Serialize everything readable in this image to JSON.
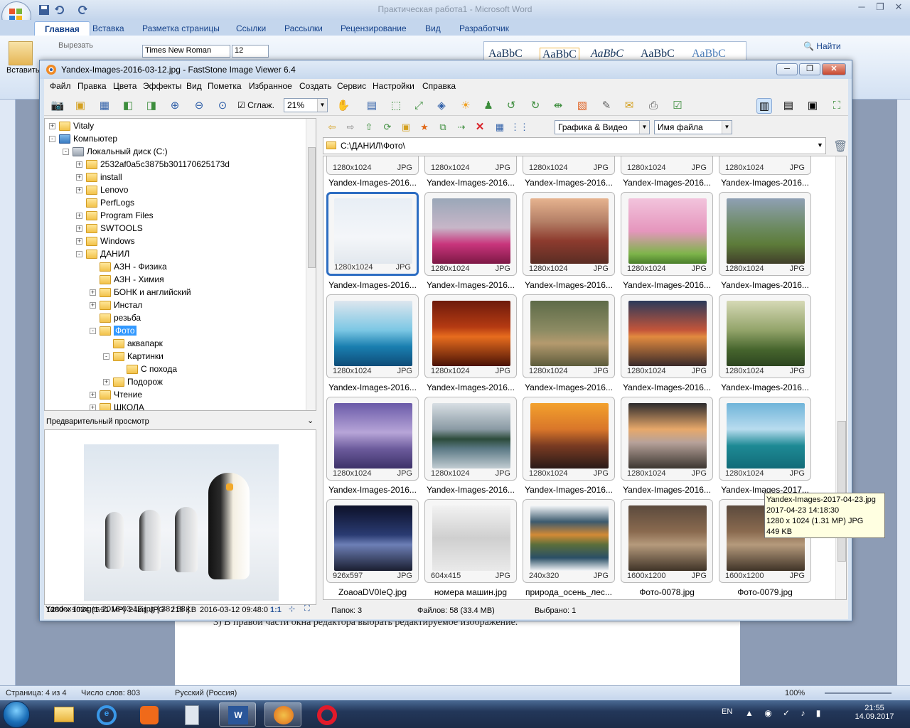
{
  "word": {
    "title": "Практическая работа1 - Microsoft Word",
    "tabs": [
      "Главная",
      "Вставка",
      "Разметка страницы",
      "Ссылки",
      "Рассылки",
      "Рецензирование",
      "Вид",
      "Разработчик"
    ],
    "clipboard": {
      "cut": "Вырезать",
      "paste": "Вставить"
    },
    "font_name": "Times New Roman",
    "font_size": "12",
    "style_sample": "АаВbС",
    "find_label": "Найти",
    "doc_text": "3) В правой части окна редактора выбрать редактируемое изображение.",
    "status": {
      "page": "Страница: 4 из 4",
      "words": "Число слов: 803",
      "language": "Русский (Россия)",
      "zoom": "100%"
    }
  },
  "taskbar": {
    "lang": "EN",
    "time": "21:55",
    "date": "14.09.2017"
  },
  "fs": {
    "title": "Yandex-Images-2016-03-12.jpg  -  FastStone Image Viewer 6.4",
    "menu": [
      "Файл",
      "Правка",
      "Цвета",
      "Эффекты",
      "Вид",
      "Пометка",
      "Избранное",
      "Создать",
      "Сервис",
      "Настройки",
      "Справка"
    ],
    "smooth_label": "Сглаж.",
    "zoom": "21%",
    "filter": "Графика & Видео",
    "sort": "Имя файла",
    "path": "C:\\ДАНИЛ\\Фото\\",
    "preview_header": "Предварительный просмотр",
    "preview_info": {
      "dims": "1280 x 1024 (1.31 MP)",
      "bits": "24bit",
      "fmt": "JPG",
      "size": "215 KB",
      "date": "2016-03-12 09:48:0",
      "ratio": "1:1"
    },
    "status": {
      "file": "Yandex-Images-2016-03-12.jpg [ 38 / 58 ]",
      "folders": "Папок: 3",
      "files": "Файлов: 58 (33.4 MB)",
      "selected": "Выбрано: 1"
    },
    "tree": [
      {
        "label": "Vitaly",
        "depth": 0,
        "exp": "+"
      },
      {
        "label": "Компьютер",
        "depth": 0,
        "exp": "-"
      },
      {
        "label": "Локальный диск (C:)",
        "depth": 1,
        "exp": "-"
      },
      {
        "label": "2532af0a5c3875b301170625173d",
        "depth": 2,
        "exp": "+"
      },
      {
        "label": "install",
        "depth": 2,
        "exp": "+"
      },
      {
        "label": "Lenovo",
        "depth": 2,
        "exp": "+"
      },
      {
        "label": "PerfLogs",
        "depth": 2,
        "exp": ""
      },
      {
        "label": "Program Files",
        "depth": 2,
        "exp": "+"
      },
      {
        "label": "SWTOOLS",
        "depth": 2,
        "exp": "+"
      },
      {
        "label": "Windows",
        "depth": 2,
        "exp": "+"
      },
      {
        "label": "ДАНИЛ",
        "depth": 2,
        "exp": "-"
      },
      {
        "label": "АЗН - Физика",
        "depth": 3,
        "exp": ""
      },
      {
        "label": "АЗН - Химия",
        "depth": 3,
        "exp": ""
      },
      {
        "label": "БОНК и английский",
        "depth": 3,
        "exp": "+"
      },
      {
        "label": "Инстал",
        "depth": 3,
        "exp": "+"
      },
      {
        "label": "резьба",
        "depth": 3,
        "exp": ""
      },
      {
        "label": "Фото",
        "depth": 3,
        "exp": "-",
        "selected": true
      },
      {
        "label": "аквапарк",
        "depth": 4,
        "exp": ""
      },
      {
        "label": "Картинки",
        "depth": 4,
        "exp": "-"
      },
      {
        "label": "С похода",
        "depth": 5,
        "exp": ""
      },
      {
        "label": "Подорож",
        "depth": 4,
        "exp": "+"
      },
      {
        "label": "Чтение",
        "depth": 3,
        "exp": "+"
      },
      {
        "label": "ШКОЛА",
        "depth": 3,
        "exp": "+"
      }
    ],
    "top_row": [
      {
        "dims": "1280x1024",
        "fmt": "JPG",
        "name": "Yandex-Images-2016..."
      },
      {
        "dims": "1280x1024",
        "fmt": "JPG",
        "name": "Yandex-Images-2016..."
      },
      {
        "dims": "1280x1024",
        "fmt": "JPG",
        "name": "Yandex-Images-2016..."
      },
      {
        "dims": "1280x1024",
        "fmt": "JPG",
        "name": "Yandex-Images-2016..."
      },
      {
        "dims": "1280x1024",
        "fmt": "JPG",
        "name": "Yandex-Images-2016..."
      }
    ],
    "thumbs": [
      {
        "dims": "1280x1024",
        "fmt": "JPG",
        "name": "Yandex-Images-2016...",
        "bg": "linear-gradient(#e8eef5,#f4f6f9 60%,#e2e8ee)",
        "selected": true
      },
      {
        "dims": "1280x1024",
        "fmt": "JPG",
        "name": "Yandex-Images-2016...",
        "bg": "linear-gradient(#9aa7b8,#c7b6c8 45%,#c9357c 70%,#7d1845)"
      },
      {
        "dims": "1280x1024",
        "fmt": "JPG",
        "name": "Yandex-Images-2016...",
        "bg": "linear-gradient(#e6b38f,#b58067 35%,#8d3b2e 65%,#5a2d24)"
      },
      {
        "dims": "1280x1024",
        "fmt": "JPG",
        "name": "Yandex-Images-2016...",
        "bg": "linear-gradient(#f2c4dc,#e596bd 50%,#7db44a 85%,#4a7e2b)"
      },
      {
        "dims": "1280x1024",
        "fmt": "JPG",
        "name": "Yandex-Images-2016...",
        "bg": "linear-gradient(#8fa0b4,#6c8a60 45%,#5d7c3a 70%,#413f2a)"
      },
      {
        "dims": "1280x1024",
        "fmt": "JPG",
        "name": "Yandex-Images-2016...",
        "bg": "linear-gradient(#dde6ee,#7cc7e4 45%,#1a7fb0 70%,#0e4c78)"
      },
      {
        "dims": "1280x1024",
        "fmt": "JPG",
        "name": "Yandex-Images-2016...",
        "bg": "linear-gradient(#6e1b0c,#b43a12 40%,#e76c1e 55%,#4a1206)"
      },
      {
        "dims": "1280x1024",
        "fmt": "JPG",
        "name": "Yandex-Images-2016...",
        "bg": "linear-gradient(#5e6b48,#8c8b63 45%,#b49a6e 65%,#5d5c3c)"
      },
      {
        "dims": "1280x1024",
        "fmt": "JPG",
        "name": "Yandex-Images-2016...",
        "bg": "linear-gradient(#2b3a5a,#c4553a 45%,#e28a3f 55%,#3a2a2a)"
      },
      {
        "dims": "1280x1024",
        "fmt": "JPG",
        "name": "Yandex-Images-2016...",
        "bg": "linear-gradient(#d6d9b6,#93a46a 45%,#46652d 75%,#2d4520)"
      },
      {
        "dims": "1280x1024",
        "fmt": "JPG",
        "name": "Yandex-Images-2016...",
        "bg": "linear-gradient(#6a5aa8,#b7a5d8 45%,#6c5b9c 70%,#3d3269)"
      },
      {
        "dims": "1280x1024",
        "fmt": "JPG",
        "name": "Yandex-Images-2016...",
        "bg": "linear-gradient(#d8dfe4,#8a9aa4 40%,#2c4b3a 55%,#5c7a86 70%,#c2cdd2)"
      },
      {
        "dims": "1280x1024",
        "fmt": "JPG",
        "name": "Yandex-Images-2016...",
        "bg": "linear-gradient(#f3a12c,#d9762a 40%,#7a3b22 65%,#2a1a18)"
      },
      {
        "dims": "1280x1024",
        "fmt": "JPG",
        "name": "Yandex-Images-2016...",
        "bg": "linear-gradient(#2b2a2c,#e7a86a 40%,#b7a29a 60%,#3c3630)"
      },
      {
        "dims": "1280x1024",
        "fmt": "JPG",
        "name": "Yandex-Images-2017...",
        "bg": "linear-gradient(#6fb4d9,#b8dcef 40%,#1e8a95 65%,#116b78)"
      },
      {
        "dims": "926x597",
        "fmt": "JPG",
        "name": "ZoaoaDV0IeQ.jpg",
        "bg": "linear-gradient(#0c1028,#2a3b72 45%,#6d7fb6 60%,#1a1e30)"
      },
      {
        "dims": "604x415",
        "fmt": "JPG",
        "name": "номера машин.jpg",
        "bg": "linear-gradient(#f2f2f2,#cfcfcf 50%,#eaeaea)"
      },
      {
        "dims": "240x320",
        "fmt": "JPG",
        "name": "природа_осень_лес...",
        "bg": "linear-gradient(#f4f6f9,#3c5a6e 25%,#d38a35 45%,#5a6e3b 60%,#2b4f66 80%,#f4f6f9)"
      },
      {
        "dims": "1600x1200",
        "fmt": "JPG",
        "name": "Фото-0078.jpg",
        "bg": "linear-gradient(#5b4a3d,#8a6a4f 40%,#b59a7c 60%,#3f3327)"
      },
      {
        "dims": "1600x1200",
        "fmt": "JPG",
        "name": "Фото-0079.jpg",
        "bg": "linear-gradient(#5b4a3d,#8a6a4f 40%,#b59a7c 60%,#3f3327)"
      }
    ],
    "tooltip": {
      "name": "Yandex-Images-2017-04-23.jpg",
      "date": "2017-04-23 14:18:30",
      "dims": "1280 x 1024 (1.31 MP)  JPG",
      "size": "449 KB"
    }
  }
}
